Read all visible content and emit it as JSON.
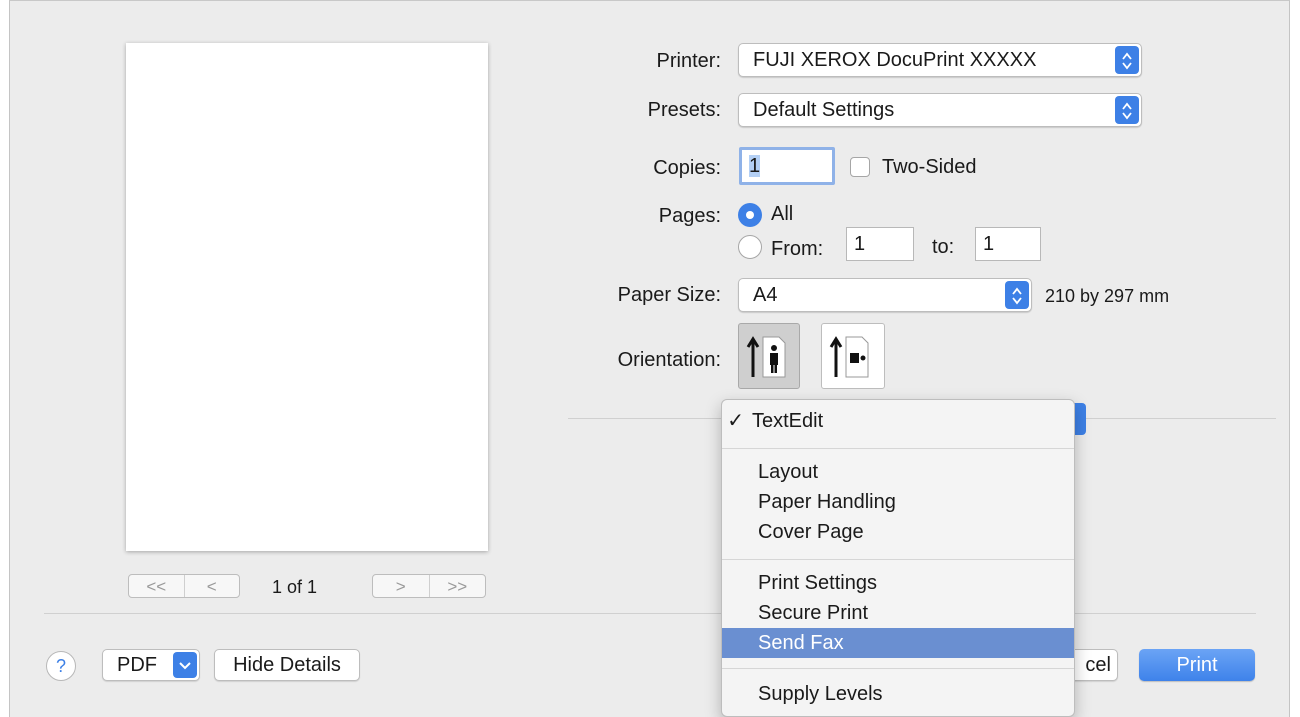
{
  "printer": {
    "label": "Printer:",
    "value": "FUJI XEROX DocuPrint XXXXX"
  },
  "presets": {
    "label": "Presets:",
    "value": "Default Settings"
  },
  "copies": {
    "label": "Copies:",
    "value": "1",
    "two_sided_label": "Two-Sided"
  },
  "pages": {
    "label": "Pages:",
    "all_label": "All",
    "from_label": "From:",
    "from_value": "1",
    "to_label": "to:",
    "to_value": "1"
  },
  "paper_size": {
    "label": "Paper Size:",
    "value": "A4",
    "dimensions": "210 by 297 mm"
  },
  "orientation": {
    "label": "Orientation:"
  },
  "preview": {
    "page_indicator": "1 of 1",
    "first_glyph": "<<",
    "prev_glyph": "<",
    "next_glyph": ">",
    "last_glyph": ">>"
  },
  "bottom": {
    "help_glyph": "?",
    "pdf_label": "PDF",
    "hide_details_label": "Hide Details",
    "cancel_partial": "cel",
    "print_label": "Print"
  },
  "menu": {
    "checked_item": "TextEdit",
    "check_glyph": "✓",
    "group1": [
      "Layout",
      "Paper Handling",
      "Cover Page"
    ],
    "group2": [
      "Print Settings",
      "Secure Print",
      "Send Fax"
    ],
    "group3": [
      "Supply Levels"
    ],
    "highlighted": "Send Fax"
  },
  "colors": {
    "accent": "#3d80e6",
    "menu_highlight": "#6a8fd1",
    "dialog_bg": "#ececec"
  }
}
